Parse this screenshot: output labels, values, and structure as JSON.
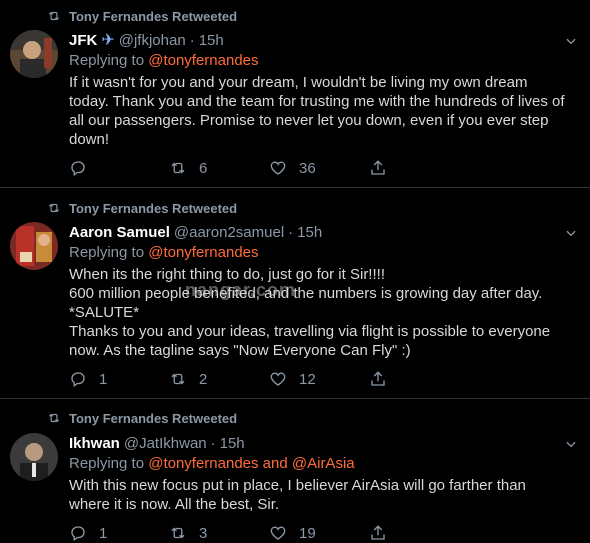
{
  "tweets": [
    {
      "retweet_label": "Tony Fernandes Retweeted",
      "name": "JFK",
      "name_emoji": "✈",
      "handle": "@jfkjohan",
      "dot": "·",
      "time": "15h",
      "replying_prefix": "Replying to ",
      "replying_mentions": "@tonyfernandes",
      "text": "If it wasn't for you and your dream, I wouldn't be living my own dream today. Thank you and the team for trusting me with the hundreds of lives of all our passengers. Promise to never let you down, even if you ever step down!",
      "replies": "",
      "retweets": "6",
      "likes": "36"
    },
    {
      "retweet_label": "Tony Fernandes Retweeted",
      "name": "Aaron Samuel",
      "handle": "@aaron2samuel",
      "dot": "·",
      "time": "15h",
      "replying_prefix": "Replying to ",
      "replying_mentions": "@tonyfernandes",
      "text": "When its the right thing to do, just go for it Sir!!!!\n600 million people benefited, and the numbers is growing day after day.\n*SALUTE*\nThanks to you and your ideas, travelling via flight is possible to everyone now. As the tagline says \"Now Everyone Can Fly\" :)",
      "replies": "1",
      "retweets": "2",
      "likes": "12"
    },
    {
      "retweet_label": "Tony Fernandes Retweeted",
      "name": "Ikhwan",
      "handle": "@JatIkhwan",
      "dot": "·",
      "time": "15h",
      "replying_prefix": "Replying to ",
      "replying_mentions": "@tonyfernandes and @AirAsia",
      "text": "With this new focus put in place, I believer AirAsia will go farther than where it is now. All the best, Sir.",
      "replies": "1",
      "retweets": "3",
      "likes": "19"
    }
  ],
  "watermark": "nangar.com",
  "icons": {
    "retweet_indicator": "retweet-icon",
    "menu": "chevron-down-icon",
    "reply": "reply-icon",
    "retweet": "retweet-icon",
    "like": "heart-icon",
    "share": "share-icon"
  },
  "colors": {
    "background": "#000000",
    "divider": "#2f3336",
    "secondary_text": "#8b98a5",
    "mention": "#ff6b3b"
  }
}
